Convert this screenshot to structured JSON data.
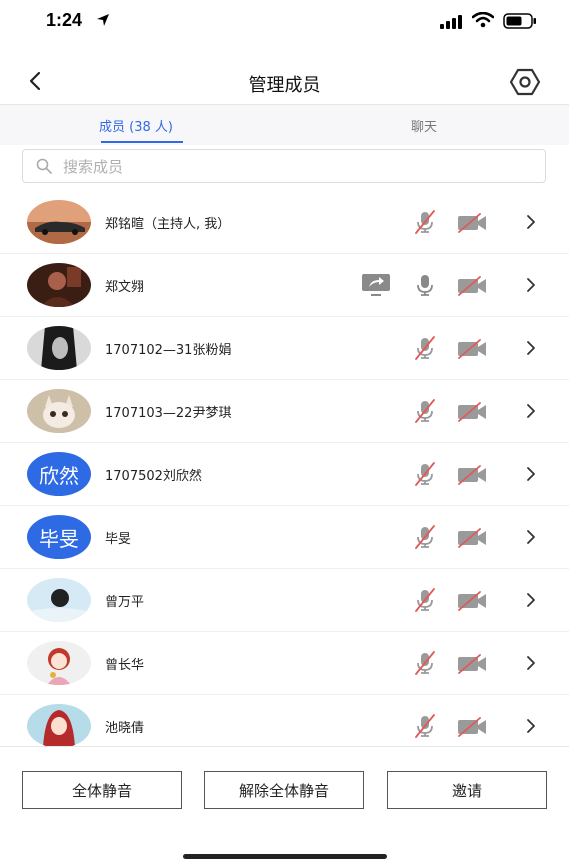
{
  "status_bar": {
    "time": "1:24"
  },
  "nav": {
    "title": "管理成员",
    "back_icon": "chevron-left-icon",
    "settings_icon": "gear-icon"
  },
  "tabs": [
    {
      "label": "成员 (38 人)",
      "active": true
    },
    {
      "label": "聊天",
      "active": false
    }
  ],
  "search": {
    "placeholder": "搜索成员",
    "value": ""
  },
  "members": [
    {
      "name": "郑铭暄（主持人, 我）",
      "avatar_type": "photo-car",
      "screen_share": false,
      "mic_on": false,
      "camera_on": false
    },
    {
      "name": "郑文翙",
      "avatar_type": "photo-dark",
      "screen_share": true,
      "mic_on": true,
      "camera_on": false
    },
    {
      "name": "1707102—31张粉娟",
      "avatar_type": "photo-bw",
      "screen_share": false,
      "mic_on": false,
      "camera_on": false
    },
    {
      "name": "1707103—22尹梦琪",
      "avatar_type": "photo-cat",
      "screen_share": false,
      "mic_on": false,
      "camera_on": false
    },
    {
      "name": "1707502刘欣然",
      "avatar_text": "欣然",
      "avatar_color": "#2f6ae5",
      "screen_share": false,
      "mic_on": false,
      "camera_on": false
    },
    {
      "name": "毕旻",
      "avatar_text": "毕旻",
      "avatar_color": "#2f6ae5",
      "screen_share": false,
      "mic_on": false,
      "camera_on": false
    },
    {
      "name": "曾万平",
      "avatar_type": "photo-sky",
      "screen_share": false,
      "mic_on": false,
      "camera_on": false
    },
    {
      "name": "曾长华",
      "avatar_type": "photo-girl",
      "screen_share": false,
      "mic_on": false,
      "camera_on": false
    },
    {
      "name": "池晓倩",
      "avatar_type": "photo-redhood",
      "screen_share": false,
      "mic_on": false,
      "camera_on": false
    }
  ],
  "actions": {
    "mute_all": "全体静音",
    "unmute_all": "解除全体静音",
    "invite": "邀请"
  },
  "colors": {
    "accent": "#2f6ae5",
    "muted_red": "#e05a5a",
    "icon_gray": "#8a8a8a"
  }
}
